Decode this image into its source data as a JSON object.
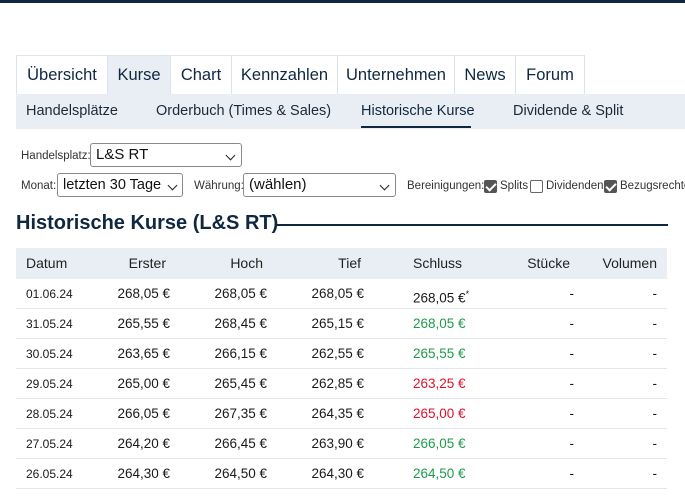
{
  "tabs": [
    {
      "label": "Übersicht",
      "active": false
    },
    {
      "label": "Kurse",
      "active": true
    },
    {
      "label": "Chart",
      "active": false
    },
    {
      "label": "Kennzahlen",
      "active": false
    },
    {
      "label": "Unternehmen",
      "active": false
    },
    {
      "label": "News",
      "active": false
    },
    {
      "label": "Forum",
      "active": false
    }
  ],
  "subtabs": [
    {
      "label": "Handelsplätze",
      "active": false
    },
    {
      "label": "Orderbuch (Times & Sales)",
      "active": false
    },
    {
      "label": "Historische Kurse",
      "active": true
    },
    {
      "label": "Dividende & Split",
      "active": false
    }
  ],
  "filters": {
    "handelsplatz_label": "Handelsplatz:",
    "handelsplatz_value": "L&S RT",
    "monat_label": "Monat:",
    "monat_value": "letzten 30 Tage",
    "waehrung_label": "Währung:",
    "waehrung_value": "(wählen)",
    "bereinigungen_label": "Bereinigungen:",
    "options": [
      {
        "label": "Splits",
        "checked": true
      },
      {
        "label": "Dividenden",
        "checked": false
      },
      {
        "label": "Bezugsrechte",
        "checked": true
      }
    ]
  },
  "section_title": "Historische Kurse (L&S RT)",
  "table": {
    "columns": [
      "Datum",
      "Erster",
      "Hoch",
      "Tief",
      "Schluss",
      "Stücke",
      "Volumen"
    ],
    "rows": [
      {
        "datum": "01.06.24",
        "erster": "268,05 €",
        "hoch": "268,05 €",
        "tief": "268,05 €",
        "schluss": "268,05 €",
        "note": "*",
        "trend": "neutral",
        "stuecke": "-",
        "volumen": "-"
      },
      {
        "datum": "31.05.24",
        "erster": "265,55 €",
        "hoch": "268,45 €",
        "tief": "265,15 €",
        "schluss": "268,05 €",
        "note": "",
        "trend": "up",
        "stuecke": "-",
        "volumen": "-"
      },
      {
        "datum": "30.05.24",
        "erster": "263,65 €",
        "hoch": "266,15 €",
        "tief": "262,55 €",
        "schluss": "265,55 €",
        "note": "",
        "trend": "up",
        "stuecke": "-",
        "volumen": "-"
      },
      {
        "datum": "29.05.24",
        "erster": "265,00 €",
        "hoch": "265,45 €",
        "tief": "262,85 €",
        "schluss": "263,25 €",
        "note": "",
        "trend": "down",
        "stuecke": "-",
        "volumen": "-"
      },
      {
        "datum": "28.05.24",
        "erster": "266,05 €",
        "hoch": "267,35 €",
        "tief": "264,35 €",
        "schluss": "265,00 €",
        "note": "",
        "trend": "down",
        "stuecke": "-",
        "volumen": "-"
      },
      {
        "datum": "27.05.24",
        "erster": "264,20 €",
        "hoch": "266,45 €",
        "tief": "263,90 €",
        "schluss": "266,05 €",
        "note": "",
        "trend": "up",
        "stuecke": "-",
        "volumen": "-"
      },
      {
        "datum": "26.05.24",
        "erster": "264,30 €",
        "hoch": "264,50 €",
        "tief": "264,30 €",
        "schluss": "264,50 €",
        "note": "",
        "trend": "up",
        "stuecke": "-",
        "volumen": "-"
      }
    ]
  },
  "colors": {
    "navy": "#0f2741",
    "up": "#1e9b4a",
    "down": "#e0102a",
    "header_bg": "#e9eef4"
  }
}
